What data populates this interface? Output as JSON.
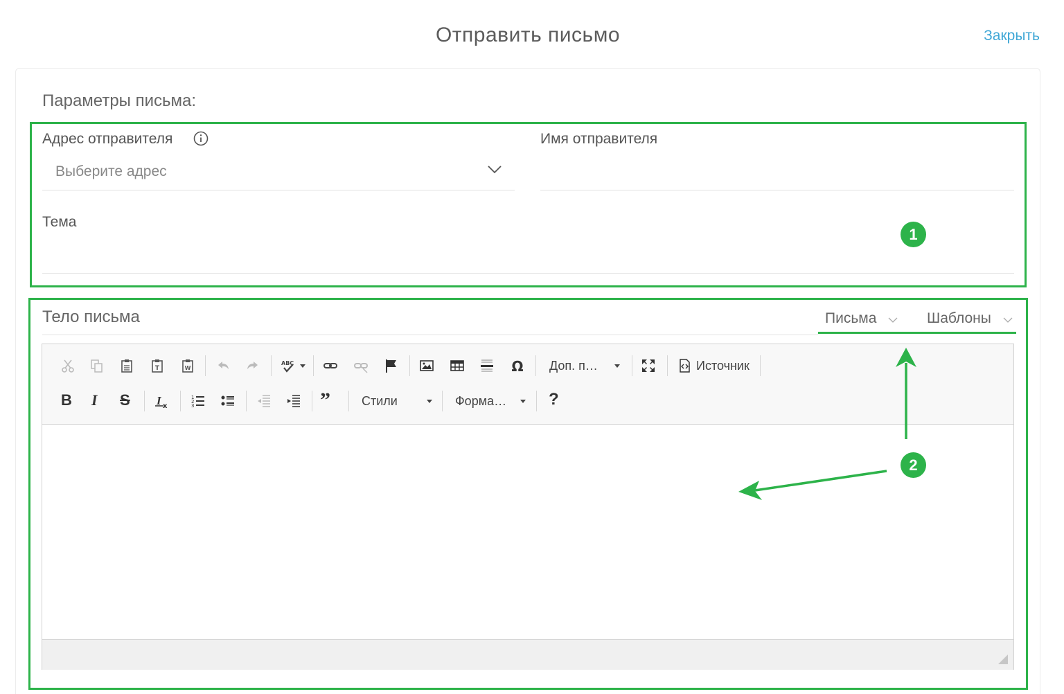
{
  "header": {
    "title": "Отправить письмо",
    "close_label": "Закрыть"
  },
  "params": {
    "title": "Параметры письма:",
    "sender_address_label": "Адрес отправителя",
    "sender_address_placeholder": "Выберите адрес",
    "sender_name_label": "Имя отправителя",
    "subject_label": "Тема"
  },
  "body": {
    "title": "Тело письма",
    "tabs": [
      {
        "label": "Письма"
      },
      {
        "label": "Шаблоны"
      }
    ]
  },
  "toolbar": {
    "extra_plugins_label": "Доп. п…",
    "source_label": "Источник",
    "styles_label": "Стили",
    "format_label": "Форма…",
    "help_label": "?",
    "icons": [
      "cut-icon",
      "copy-icon",
      "paste-icon",
      "paste-text-icon",
      "paste-word-icon",
      "undo-icon",
      "redo-icon",
      "spellcheck-icon",
      "link-icon",
      "unlink-icon",
      "anchor-flag-icon",
      "image-icon",
      "table-icon",
      "horizontal-rule-icon",
      "special-char-icon",
      "maximize-icon",
      "source-icon",
      "bold-icon",
      "italic-icon",
      "strike-icon",
      "remove-format-icon",
      "numbered-list-icon",
      "bulleted-list-icon",
      "outdent-icon",
      "indent-icon",
      "blockquote-icon",
      "help-icon"
    ]
  },
  "annotations": {
    "badge1": "1",
    "badge2": "2"
  },
  "colors": {
    "accent_green": "#2db34a",
    "link_blue": "#3fa7d6"
  }
}
